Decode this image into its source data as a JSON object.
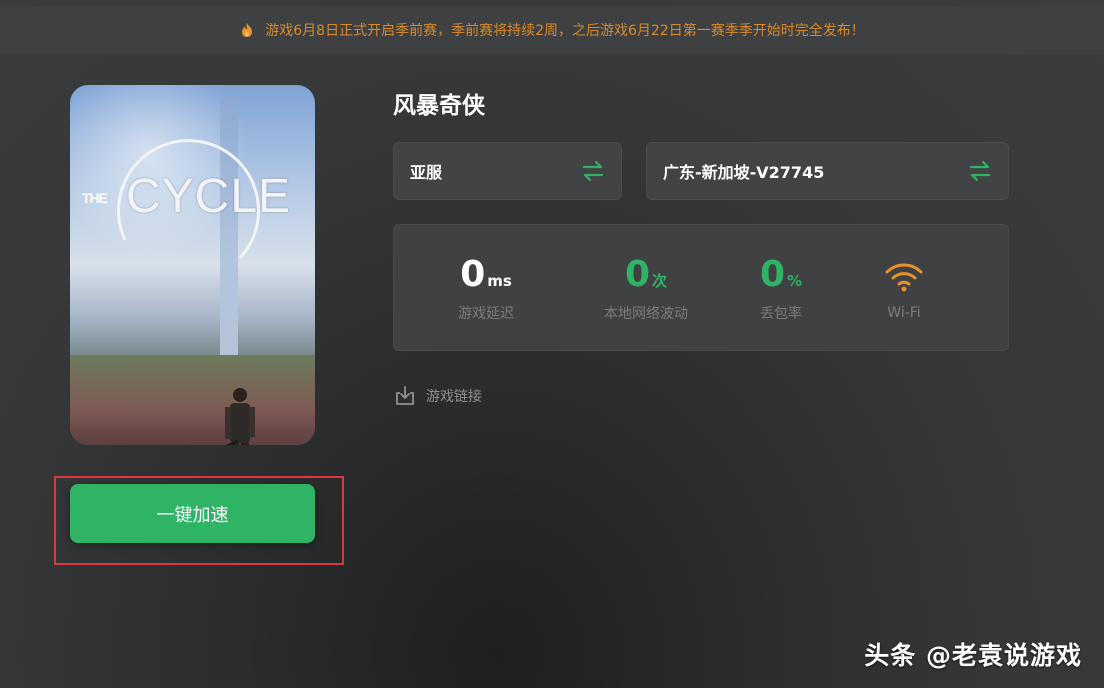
{
  "announcement": {
    "icon": "fire-icon",
    "text": "游戏6月8日正式开启季前赛，季前赛将持续2周，之后游戏6月22日第一赛季季开始时完全发布！"
  },
  "game": {
    "title": "风暴奇侠",
    "cover_logo": {
      "the": "THE",
      "cycle": "CYCLE"
    }
  },
  "accelerate_button": {
    "label": "一键加速"
  },
  "region_select": {
    "value": "亚服",
    "icon": "swap-arrows-icon"
  },
  "node_select": {
    "value": "广东-新加坡-V27745",
    "icon": "swap-arrows-icon"
  },
  "stats": {
    "latency": {
      "value": "0",
      "unit": "ms",
      "label": "游戏延迟"
    },
    "jitter": {
      "value": "0",
      "unit": "次",
      "label": "本地网络波动"
    },
    "packet_loss": {
      "value": "0",
      "unit": "%",
      "label": "丢包率"
    },
    "connection": {
      "icon": "wifi-icon",
      "label": "Wi-Fi"
    }
  },
  "game_link": {
    "icon": "download-icon",
    "label": "游戏链接"
  },
  "watermark": "头条 @老袁说游戏",
  "colors": {
    "accent_green": "#2fb466",
    "warning_orange": "#d98a2a",
    "highlight_red": "#d9393e",
    "wifi_orange": "#e8912d"
  }
}
